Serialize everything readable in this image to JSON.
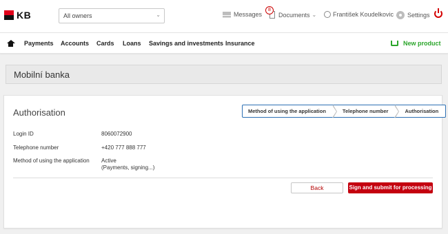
{
  "header": {
    "logo_text": "KB",
    "owner_select": {
      "value": "All owners"
    },
    "messages_label": "Messages",
    "documents_label": "Documents",
    "documents_badge": "8",
    "user_name": "František Koudelkovic",
    "settings_label": "Settings"
  },
  "nav": {
    "items": [
      "Payments",
      "Accounts",
      "Cards",
      "Loans",
      "Savings and investments",
      "Insurance"
    ],
    "new_product": "New product"
  },
  "section_title": "Mobilní banka",
  "authorisation": {
    "title": "Authorisation",
    "steps": [
      "Method of using the application",
      "Telephone number",
      "Authorisation"
    ],
    "rows": [
      {
        "label": "Login ID",
        "value": "8060072900"
      },
      {
        "label": "Telephone number",
        "value": "+420 777 888 777"
      },
      {
        "label": "Method of using the application",
        "value": "Active",
        "value2": "(Payments, signing...)"
      }
    ],
    "back_label": "Back",
    "submit_label": "Sign and submit for processing"
  },
  "colors": {
    "brand_red": "#c4000f",
    "accent_green": "#2aa52a",
    "step_border": "#2b6fb3"
  }
}
